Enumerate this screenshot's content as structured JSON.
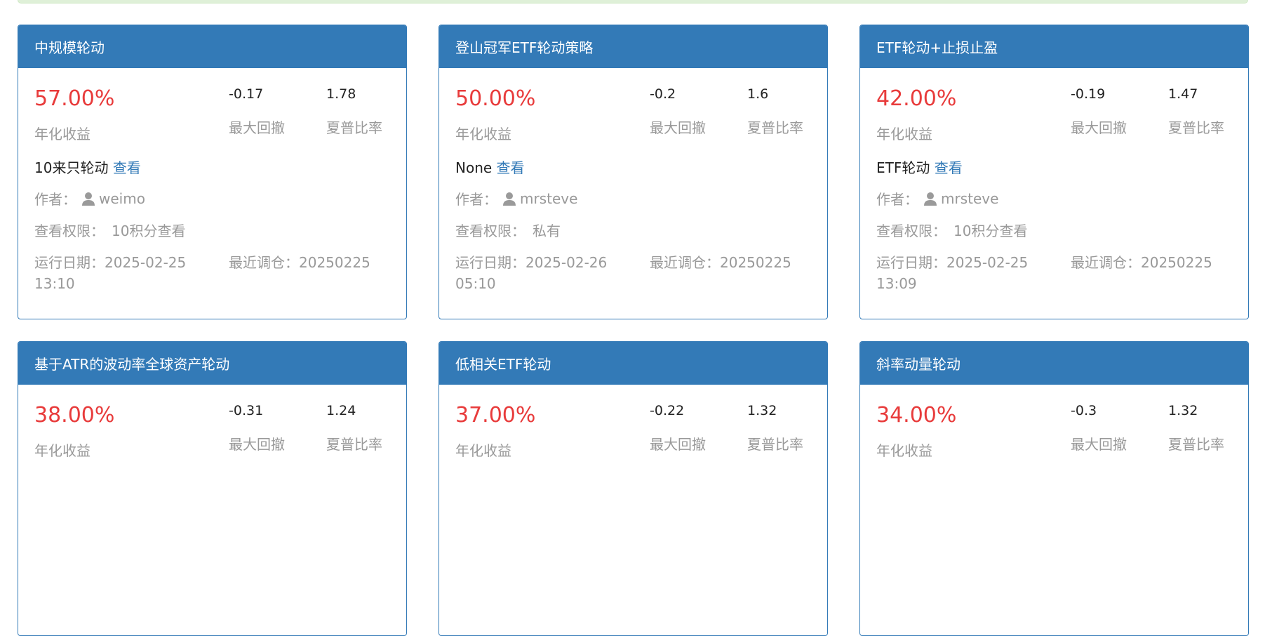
{
  "labels": {
    "annual_return": "年化收益",
    "max_drawdown": "最大回撤",
    "sharpe": "夏普比率",
    "view": "查看",
    "author": "作者：",
    "permission": "查看权限：",
    "run_date": "运行日期：",
    "last_rebalance": "最近调仓："
  },
  "colors": {
    "header_bg": "#337ab7",
    "return_red": "#e83b3b",
    "muted": "#999999",
    "link": "#337ab7"
  },
  "cards": [
    {
      "title": "中规模轮动",
      "annual_return": "57.00%",
      "max_drawdown": "-0.17",
      "sharpe": "1.78",
      "desc": "10来只轮动",
      "author": "weimo",
      "permission": "10积分查看",
      "run_date": "2025-02-25",
      "run_time": "13:10",
      "last_rebalance": "20250225"
    },
    {
      "title": "登山冠军ETF轮动策略",
      "annual_return": "50.00%",
      "max_drawdown": "-0.2",
      "sharpe": "1.6",
      "desc": "None",
      "author": "mrsteve",
      "permission": "私有",
      "run_date": "2025-02-26",
      "run_time": "05:10",
      "last_rebalance": "20250225"
    },
    {
      "title": "ETF轮动+止损止盈",
      "annual_return": "42.00%",
      "max_drawdown": "-0.19",
      "sharpe": "1.47",
      "desc": "ETF轮动",
      "author": "mrsteve",
      "permission": "10积分查看",
      "run_date": "2025-02-25",
      "run_time": "13:09",
      "last_rebalance": "20250225"
    },
    {
      "title": "基于ATR的波动率全球资产轮动",
      "annual_return": "38.00%",
      "max_drawdown": "-0.31",
      "sharpe": "1.24"
    },
    {
      "title": "低相关ETF轮动",
      "annual_return": "37.00%",
      "max_drawdown": "-0.22",
      "sharpe": "1.32"
    },
    {
      "title": "斜率动量轮动",
      "annual_return": "34.00%",
      "max_drawdown": "-0.3",
      "sharpe": "1.32"
    }
  ]
}
